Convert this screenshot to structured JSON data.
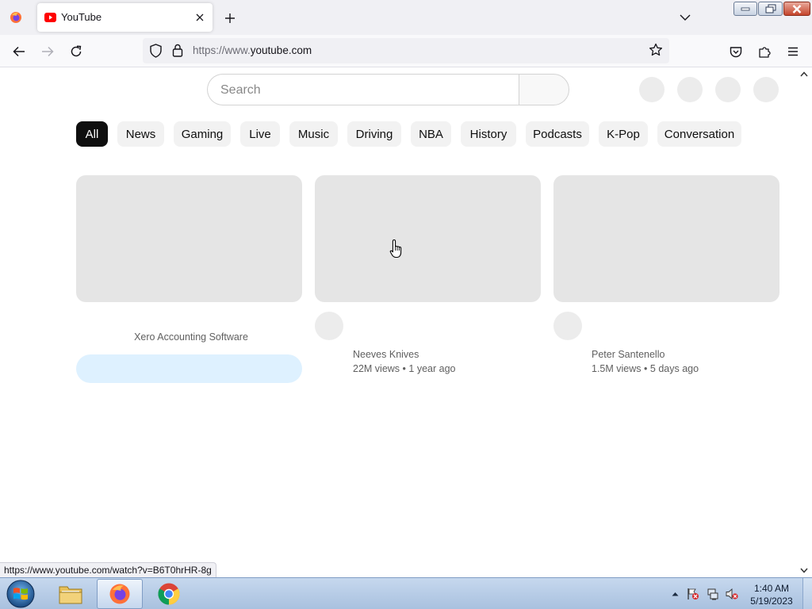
{
  "browser": {
    "tab": {
      "title": "YouTube"
    },
    "address": {
      "prefix": "https://www.",
      "domain": "youtube.com"
    },
    "status_url": "https://www.youtube.com/watch?v=B6T0hrHR-8g"
  },
  "youtube": {
    "search": {
      "placeholder": "Search"
    },
    "chips": [
      "All",
      "News",
      "Gaming",
      "Live",
      "Music",
      "Driving",
      "NBA",
      "History",
      "Podcasts",
      "K-Pop",
      "Conversation"
    ],
    "active_chip": "All",
    "ad": {
      "advertiser": "Xero Accounting Software"
    },
    "videos": [
      {
        "channel": "Neeves Knives",
        "views": "22M views",
        "age": "1 year ago"
      },
      {
        "channel": "Peter Santenello",
        "views": "1.5M views",
        "age": "5 days ago"
      }
    ],
    "meta_separator": "•"
  },
  "taskbar": {
    "apps": [
      "windows-explorer",
      "firefox",
      "chrome"
    ],
    "active_app": "firefox",
    "clock": {
      "time": "1:40 AM",
      "date": "5/19/2023"
    }
  },
  "colors": {
    "youtube_red": "#ff0000",
    "active_chip": "#0f0f0f",
    "placeholder_gray": "#e5e5e5",
    "ad_cta": "#def1ff"
  }
}
